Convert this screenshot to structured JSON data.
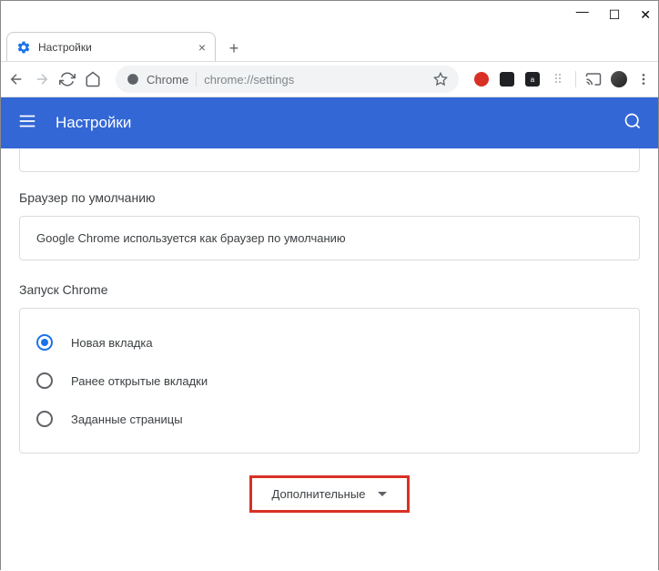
{
  "window": {
    "tab_title": "Настройки",
    "omnibox_host": "Chrome",
    "omnibox_path": "chrome://settings"
  },
  "appbar": {
    "title": "Настройки"
  },
  "sections": {
    "default_browser": {
      "title": "Браузер по умолчанию",
      "text": "Google Chrome используется как браузер по умолчанию"
    },
    "startup": {
      "title": "Запуск Chrome",
      "options": [
        {
          "label": "Новая вкладка",
          "selected": true
        },
        {
          "label": "Ранее открытые вкладки",
          "selected": false
        },
        {
          "label": "Заданные страницы",
          "selected": false
        }
      ]
    },
    "advanced_label": "Дополнительные"
  }
}
